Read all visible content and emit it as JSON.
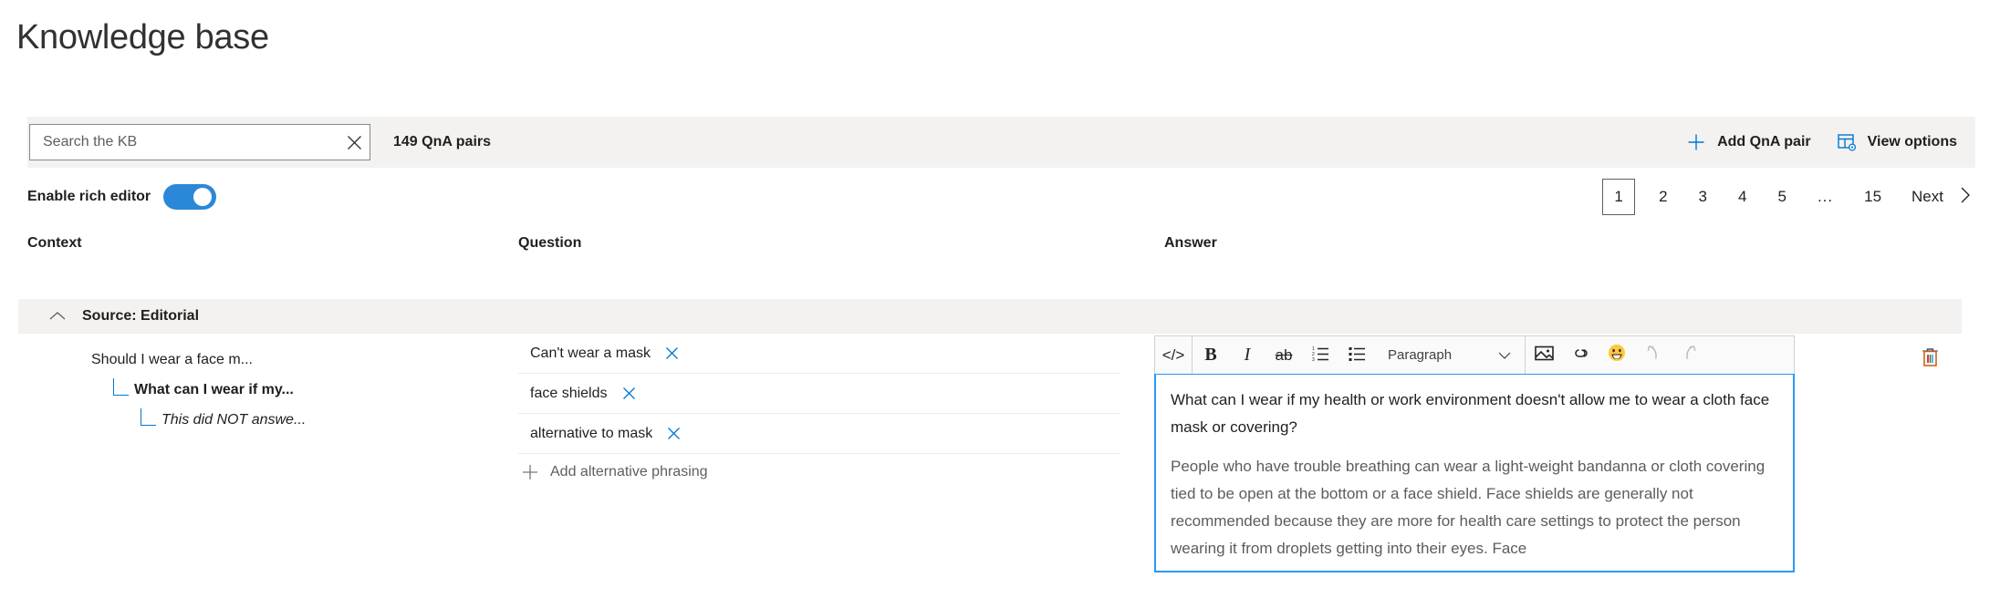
{
  "page": {
    "title": "Knowledge base"
  },
  "command_bar": {
    "search": {
      "placeholder": "Search the KB",
      "value": "",
      "clear_icon": "close-icon"
    },
    "qna_count": "149 QnA pairs",
    "add_qna_pair": {
      "label": "Add QnA pair",
      "icon": "plus-icon"
    },
    "view_options": {
      "label": "View options",
      "icon": "table-settings-icon"
    }
  },
  "sub_bar": {
    "rich_editor": {
      "label": "Enable rich editor",
      "enabled": true
    },
    "pagination": {
      "pages": [
        "1",
        "2",
        "3",
        "4",
        "5",
        "...",
        "15"
      ],
      "current": "1",
      "next_label": "Next",
      "next_icon": "chevron-right-icon"
    }
  },
  "table": {
    "columns": {
      "context": "Context",
      "question": "Question",
      "answer": "Answer"
    },
    "source_group": {
      "label": "Source: Editorial",
      "expanded": true,
      "chevron_icon": "chevron-up-icon"
    },
    "row": {
      "context_tree": [
        {
          "label": "Should I wear a face m...",
          "level": 0,
          "style": "normal"
        },
        {
          "label": "What can I wear if my...",
          "level": 1,
          "style": "bold"
        },
        {
          "label": "This did NOT answe...",
          "level": 2,
          "style": "italic"
        }
      ],
      "questions": [
        {
          "text": "Can't wear a mask",
          "remove_icon": "close-icon"
        },
        {
          "text": "face shields",
          "remove_icon": "close-icon"
        },
        {
          "text": "alternative to mask",
          "remove_icon": "close-icon"
        }
      ],
      "add_alternative": {
        "label": "Add alternative phrasing",
        "icon": "plus-icon"
      },
      "answer": {
        "toolbar": {
          "code_label": "</>",
          "bold_label": "B",
          "italic_label": "I",
          "strikethrough_label": "ab",
          "numbered_list_icon": "numbered-list-icon",
          "bulleted_list_icon": "bulleted-list-icon",
          "style_select": "Paragraph",
          "style_chevron_icon": "chevron-down-icon",
          "image_icon": "image-icon",
          "link_icon": "link-icon",
          "emoji_icon": "emoji-icon",
          "undo_icon": "undo-icon",
          "redo_icon": "redo-icon"
        },
        "paragraph_1": "What can I wear if my health or work environment doesn't allow me to wear a cloth face mask or covering?",
        "paragraph_2": "People who have trouble breathing can wear a light-weight bandanna or cloth covering tied to be open at the bottom or a face shield. Face shields are generally not recommended because they are more for health care settings to protect the person wearing it from droplets getting into their eyes. Face"
      },
      "delete_icon": "trash-icon"
    }
  },
  "colors": {
    "accent": "#0078d4",
    "toggle_on": "#2b88d8",
    "editor_focus_border": "#2899f5",
    "band_background": "#f3f2f1"
  }
}
